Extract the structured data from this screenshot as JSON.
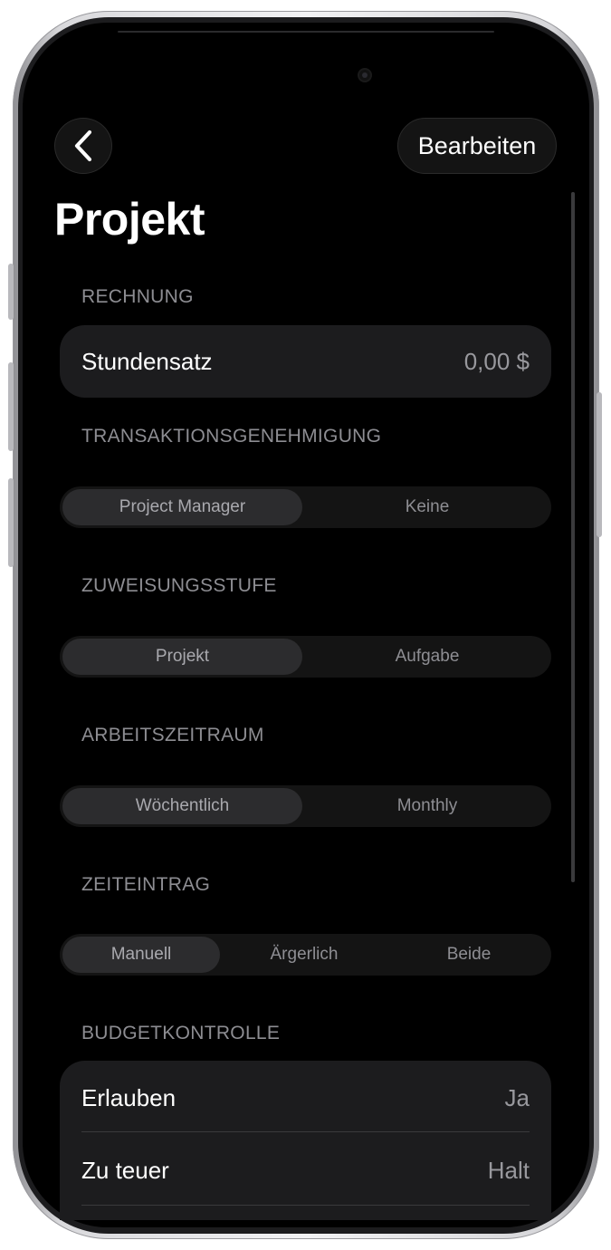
{
  "nav": {
    "edit_label": "Bearbeiten"
  },
  "page": {
    "title": "Projekt"
  },
  "sections": {
    "billing": {
      "label": "RECHNUNG",
      "rows": [
        {
          "label": "Stundensatz",
          "value": "0,00 $"
        }
      ]
    },
    "approval": {
      "label": "TRANSAKTIONSGENEHMIGUNG",
      "options": [
        "Project Manager",
        "Keine"
      ],
      "selected": "Project Manager"
    },
    "assignment": {
      "label": "ZUWEISUNGSSTUFE",
      "options": [
        "Projekt",
        "Aufgabe"
      ],
      "selected": "Projekt"
    },
    "period": {
      "label": "ARBEITSZEITRAUM",
      "options": [
        "Wöchentlich",
        "Monthly"
      ],
      "selected": "Wöchentlich"
    },
    "time_entry": {
      "label": "ZEITEINTRAG",
      "options": [
        "Manuell",
        "Ärgerlich",
        "Beide"
      ],
      "selected": "Manuell"
    },
    "budget": {
      "label": "BUDGETKONTROLLE",
      "rows": [
        {
          "label": "Erlauben",
          "value": "Ja"
        },
        {
          "label": "Zu teuer",
          "value": "Halt"
        }
      ]
    }
  }
}
